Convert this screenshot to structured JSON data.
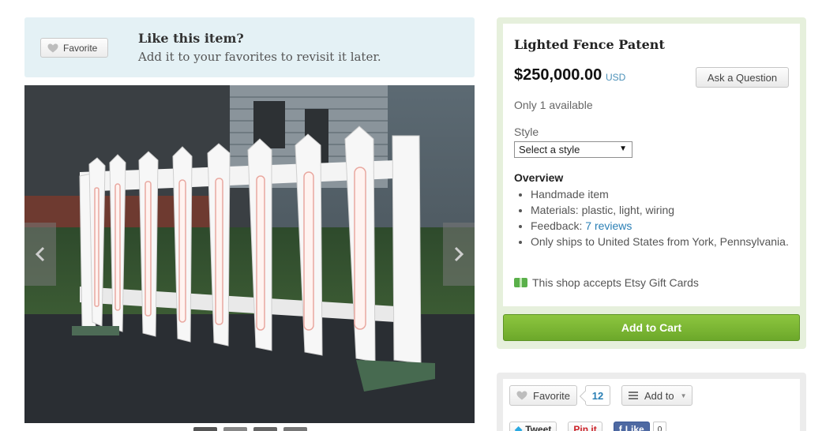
{
  "favorites_banner": {
    "button_label": "Favorite",
    "title": "Like this item?",
    "subtitle": "Add it to your favorites to revisit it later."
  },
  "gallery": {
    "prev_icon": "chevron-left-icon",
    "next_icon": "chevron-right-icon"
  },
  "listing": {
    "title": "Lighted Fence Patent",
    "price": "$250,000.00",
    "currency": "USD",
    "ask_button": "Ask a Question",
    "availability": "Only 1 available",
    "style_label": "Style",
    "style_selected": "Select a style",
    "overview_heading": "Overview",
    "overview": {
      "handmade": "Handmade item",
      "materials": "Materials: plastic, light, wiring",
      "feedback_prefix": "Feedback: ",
      "feedback_link": "7 reviews",
      "shipping": "Only ships to United States from York, Pennsylvania."
    },
    "gift_cards": "This shop accepts Etsy Gift Cards",
    "add_to_cart": "Add to Cart"
  },
  "social": {
    "favorite_label": "Favorite",
    "favorite_count": "12",
    "add_to_label": "Add to",
    "tweet_label": "Tweet",
    "pin_label": "Pin it",
    "like_label": "Like",
    "like_count": "0"
  },
  "colors": {
    "accent_green": "#7ab833",
    "link_blue": "#2a7fb5",
    "banner_bg": "#e4f1f5"
  }
}
